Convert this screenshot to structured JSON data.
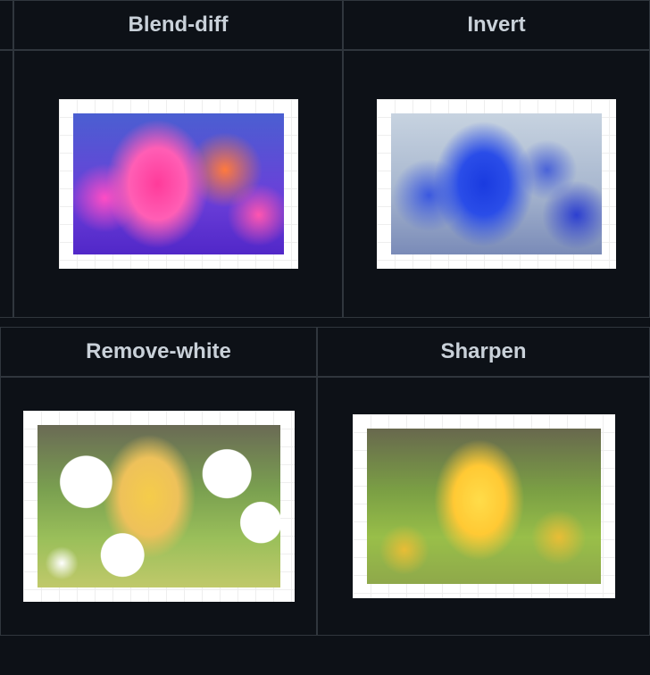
{
  "effects": {
    "top": [
      {
        "name": "blend-diff",
        "label": "Blend-diff"
      },
      {
        "name": "invert",
        "label": "Invert"
      }
    ],
    "bottom": [
      {
        "name": "remove-white",
        "label": "Remove-white"
      },
      {
        "name": "sharpen",
        "label": "Sharpen"
      }
    ]
  }
}
